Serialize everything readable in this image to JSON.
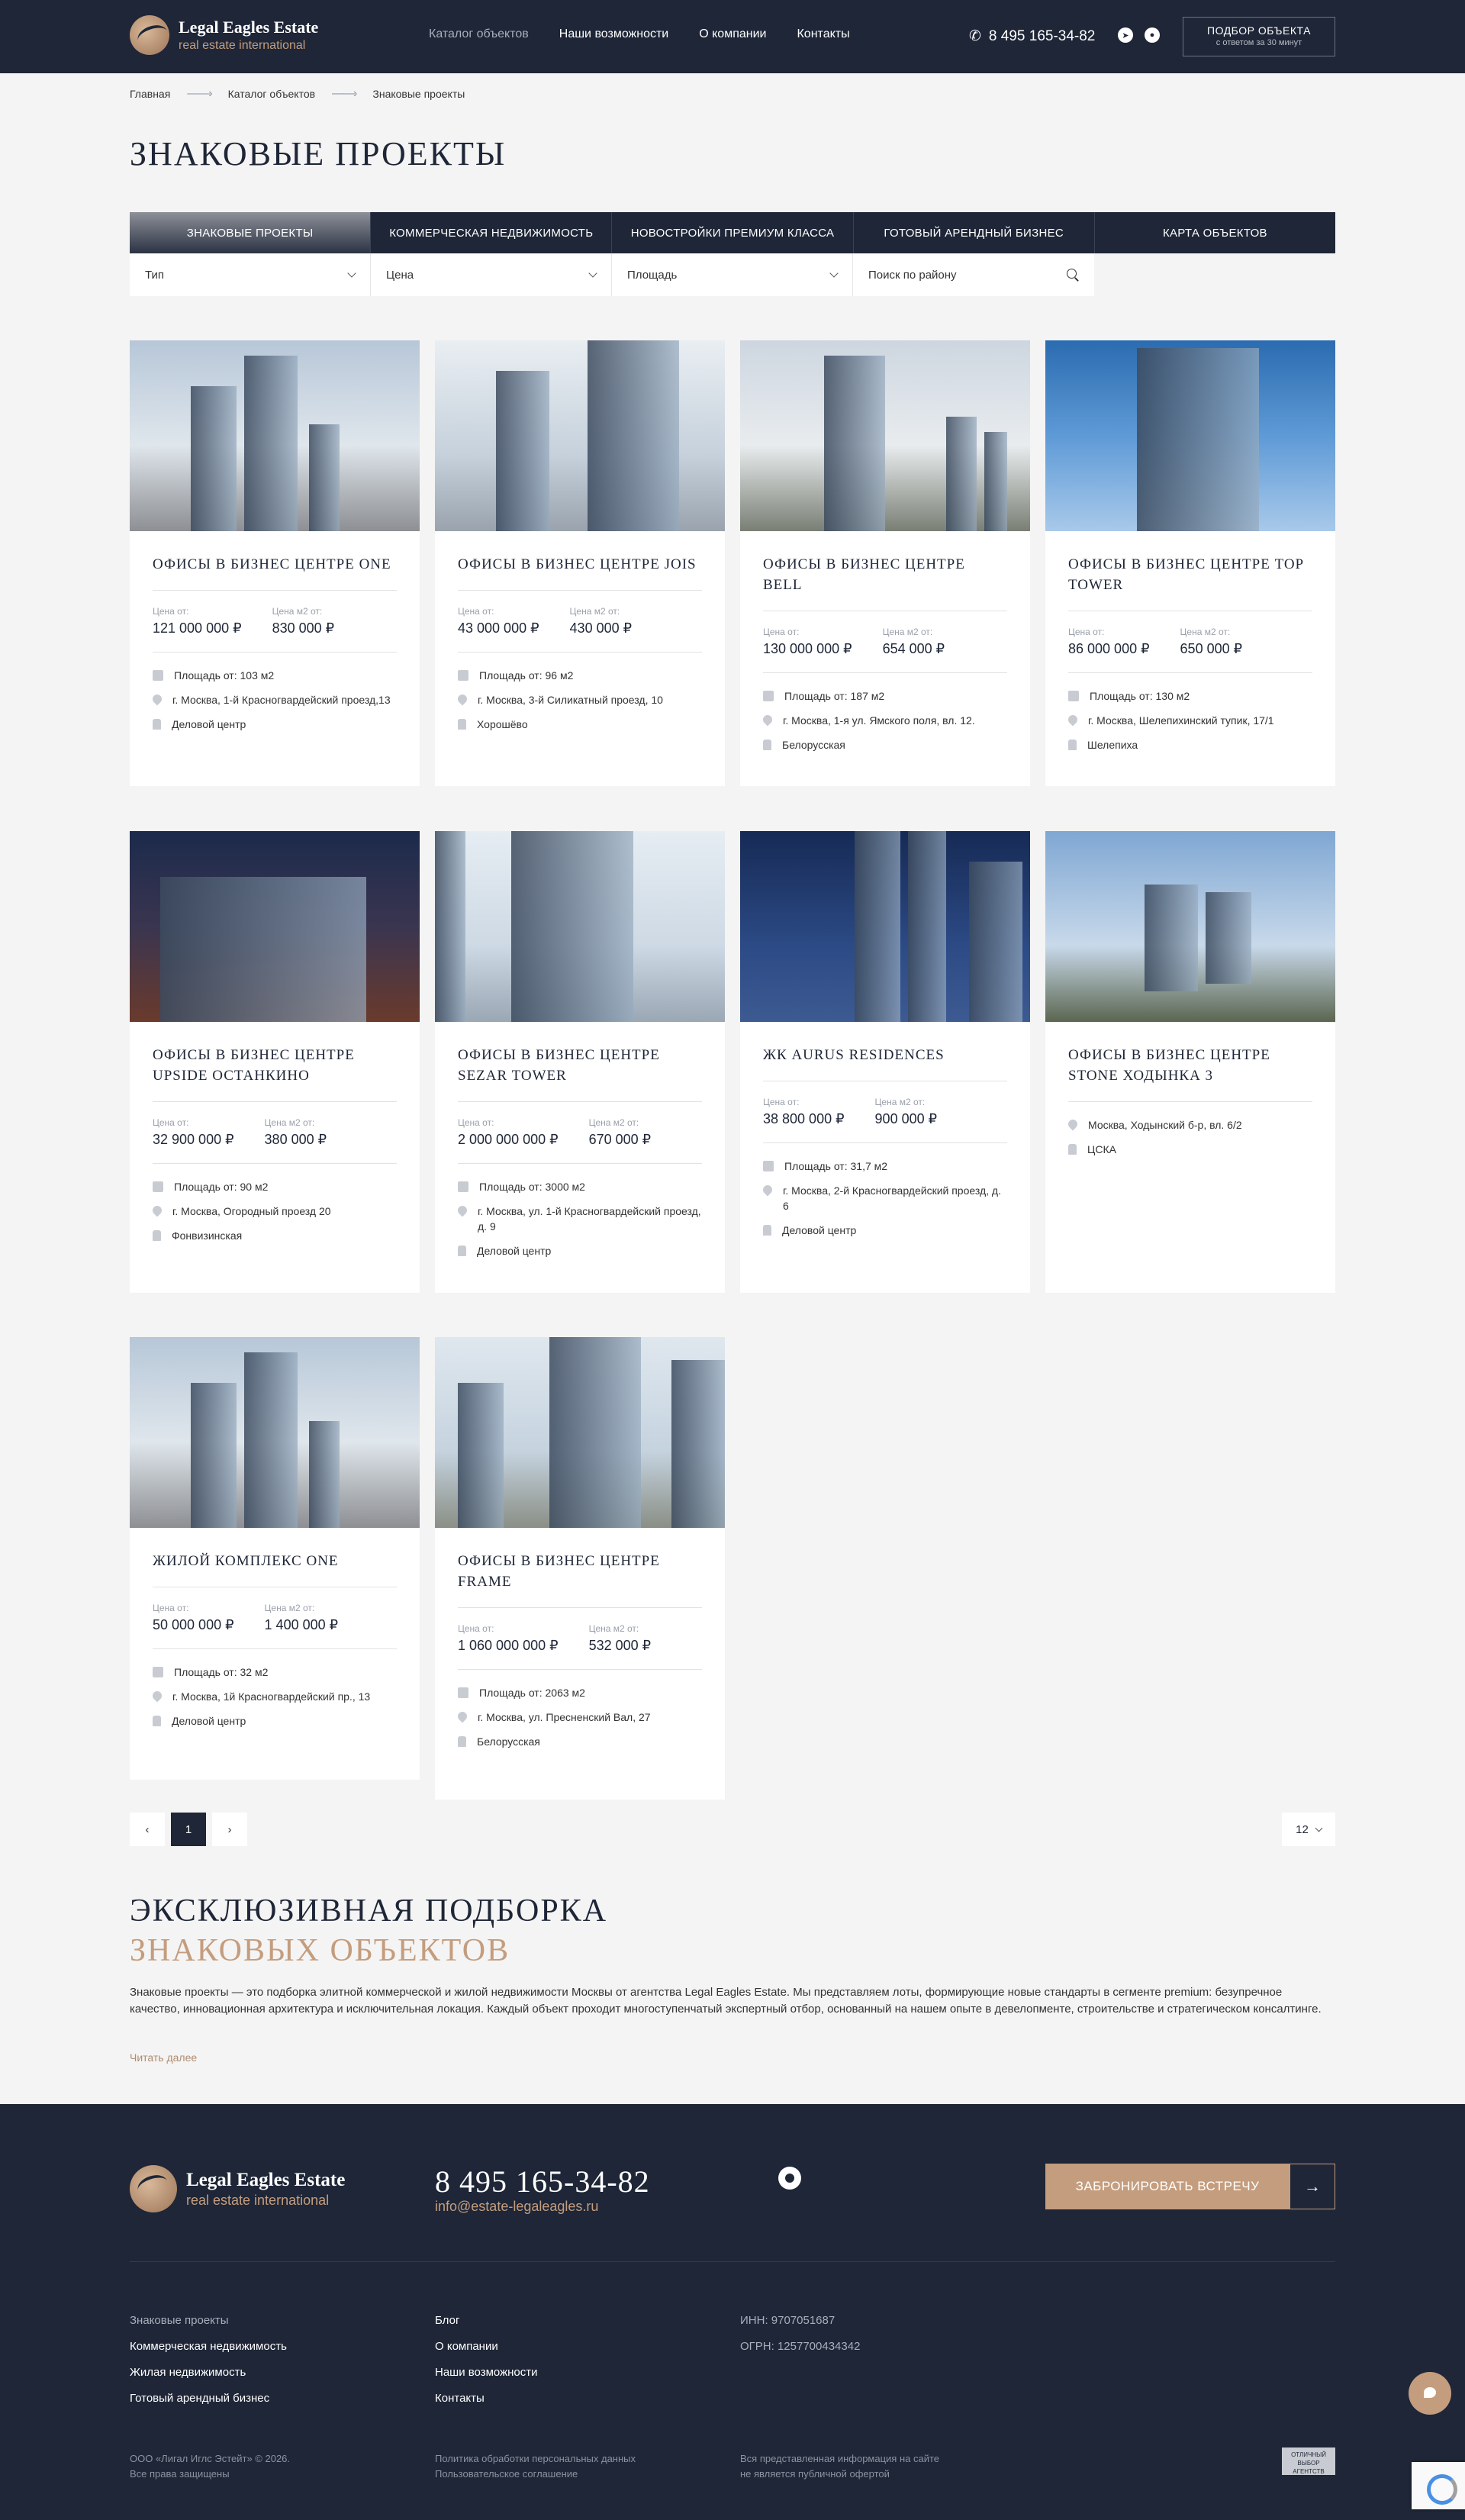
{
  "header": {
    "logo_name": "Legal Eagles Estate",
    "logo_sub": "real estate international",
    "nav": [
      {
        "label": "Каталог объектов"
      },
      {
        "label": "Наши возможности"
      },
      {
        "label": "О компании"
      },
      {
        "label": "Контакты"
      }
    ],
    "phone": "8 495 165-34-82",
    "pick_button": {
      "title": "ПОДБОР ОБЪЕКТА",
      "subtitle": "с ответом за 30 минут"
    }
  },
  "breadcrumbs": [
    "Главная",
    "Каталог объектов",
    "Знаковые проекты"
  ],
  "page_title": "ЗНАКОВЫЕ ПРОЕКТЫ",
  "tabs": [
    {
      "label": "ЗНАКОВЫЕ ПРОЕКТЫ"
    },
    {
      "label": "КОММЕРЧЕСКАЯ НЕДВИЖИМОСТЬ"
    },
    {
      "label": "НОВОСТРОЙКИ ПРЕМИУМ КЛАССА"
    },
    {
      "label": "ГОТОВЫЙ АРЕНДНЫЙ БИЗНЕС"
    },
    {
      "label": "КАРТА ОБЪЕКТОВ"
    }
  ],
  "filters": {
    "type": "Тип",
    "price": "Цена",
    "area": "Площадь",
    "search_placeholder": "Поиск по району"
  },
  "labels": {
    "price_from": "Цена от:",
    "price_m2_from": "Цена м2 от:"
  },
  "cards": [
    {
      "title": "ОФИСЫ В БИЗНЕС ЦЕНТРЕ ONE",
      "price": "121 000 000 ₽",
      "price_m2": "830 000 ₽",
      "area": "Площадь от: 103 м2",
      "address": "г. Москва, 1-й Красногвардейский проезд,13",
      "metro": "Деловой центр"
    },
    {
      "title": "ОФИСЫ В БИЗНЕС ЦЕНТРЕ JOIS",
      "price": "43 000 000 ₽",
      "price_m2": "430 000 ₽",
      "area": "Площадь от: 96 м2",
      "address": "г. Москва, 3-й Силикатный проезд, 10",
      "metro": "Хорошёво"
    },
    {
      "title": "ОФИСЫ В БИЗНЕС ЦЕНТРЕ BELL",
      "price": "130 000 000 ₽",
      "price_m2": "654 000 ₽",
      "area": "Площадь от: 187 м2",
      "address": "г. Москва, 1-я ул. Ямского поля, вл. 12.",
      "metro": "Белорусская"
    },
    {
      "title": "ОФИСЫ В БИЗНЕС ЦЕНТРЕ TOP TOWER",
      "price": "86 000 000 ₽",
      "price_m2": "650 000 ₽",
      "area": "Площадь от: 130 м2",
      "address": "г. Москва, Шелепихинский тупик, 17/1",
      "metro": "Шелепиха"
    },
    {
      "title": "ОФИСЫ В БИЗНЕС ЦЕНТРЕ UPSIDE ОСТАНКИНО",
      "price": "32 900 000 ₽",
      "price_m2": "380 000 ₽",
      "area": "Площадь от: 90 м2",
      "address": "г. Москва, Огородный проезд 20",
      "metro": "Фонвизинская"
    },
    {
      "title": "ОФИСЫ В БИЗНЕС ЦЕНТРЕ SEZAR TOWER",
      "price": "2 000 000 000 ₽",
      "price_m2": "670 000 ₽",
      "area": "Площадь от: 3000 м2",
      "address": "г. Москва, ул. 1-й Красногвардейский проезд, д. 9",
      "metro": "Деловой центр"
    },
    {
      "title": "ЖК AURUS RESIDENCES",
      "price": "38 800 000 ₽",
      "price_m2": "900 000 ₽",
      "area": "Площадь от: 31,7 м2",
      "address": "г. Москва, 2-й Красногвардейский проезд, д. 6",
      "metro": "Деловой центр"
    },
    {
      "title": "ОФИСЫ В БИЗНЕС ЦЕНТРЕ STONE ХОДЫНКА 3",
      "address": "Москва, Ходынский б-р, вл. 6/2",
      "metro": "ЦСКА"
    },
    {
      "title": "ЖИЛОЙ КОМПЛЕКС ONE",
      "price": "50 000 000 ₽",
      "price_m2": "1 400 000 ₽",
      "area": "Площадь от: 32 м2",
      "address": "г. Москва, 1й Красногвардейский пр., 13",
      "metro": "Деловой центр"
    },
    {
      "title": "ОФИСЫ В БИЗНЕС ЦЕНТРЕ FRAME",
      "price": "1 060 000 000 ₽",
      "price_m2": "532 000 ₽",
      "area": "Площадь от: 2063 м2",
      "address": "г. Москва, ул. Пресненский Вал, 27",
      "metro": "Белорусская"
    }
  ],
  "pagination": {
    "prev": "‹",
    "current": "1",
    "next": "›",
    "per_page": "12"
  },
  "seo": {
    "title_1": "ЭКСКЛЮЗИВНАЯ ПОДБОРКА",
    "title_2": "ЗНАКОВЫХ ОБЪЕКТОВ",
    "text": "Знаковые проекты — это подборка элитной коммерческой и жилой недвижимости Москвы от агентства Legal Eagles Estate. Мы представляем лоты, формирующие новые стандарты в сегменте premium: безупречное качество, инновационная архитектура и исключительная локация. Каждый объект проходит многоступенчатый экспертный отбор, основанный на нашем опыте в девелопменте, строительстве и стратегическом консалтинге.",
    "read_more": "Читать далее"
  },
  "footer": {
    "logo_name": "Legal Eagles Estate",
    "logo_sub": "real estate international",
    "phone": "8 495 165-34-82",
    "email": "info@estate-legaleagles.ru",
    "book_button": "ЗАБРОНИРОВАТЬ ВСТРЕЧУ",
    "col1": [
      "Знаковые проекты",
      "Коммерческая недвижимость",
      "Жилая недвижимость",
      "Готовый арендный бизнес"
    ],
    "col2": [
      "Блог",
      "О компании",
      "Наши возможности",
      "Контакты"
    ],
    "inn": "ИНН: 9707051687",
    "ogrn": "ОГРН: 1257700434342",
    "copyright_1": "ООО «Лигал Иглс Эстейт» © 2026.",
    "copyright_2": "Все права защищены",
    "policy": "Политика обработки персональных данных",
    "agreement": "Пользовательское соглашение",
    "disclaimer_1": "Вся представленная информация на сайте",
    "disclaimer_2": "не является публичной офертой",
    "badge": "ОТЛИЧНЫЙ ВЫБОР АГЕНТСТВ"
  },
  "colors": {
    "primary": "#1e2637",
    "accent": "#c49d7e",
    "background": "#f4f4f4"
  }
}
